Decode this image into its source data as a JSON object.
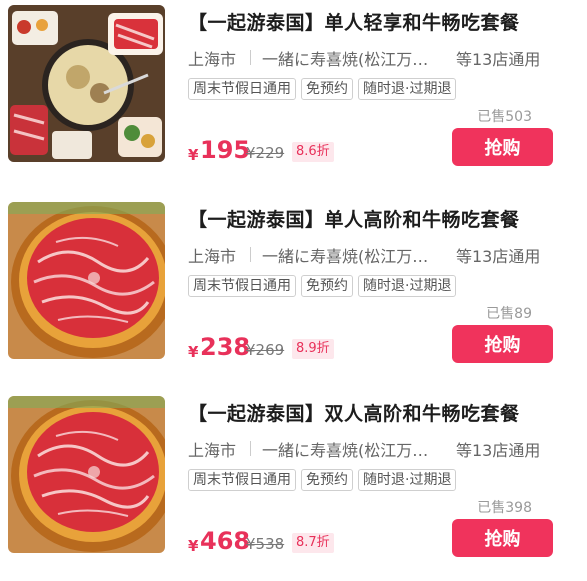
{
  "colors": {
    "accent": "#f0335c",
    "price": "#e8315a",
    "discount_bg": "#fde7ec",
    "muted_text": "#9a9a9a"
  },
  "deals": [
    {
      "image": "hotpot-table-spread-icon",
      "title": "【一起游泰国】单人轻享和牛畅吃套餐",
      "city": "上海市",
      "shop": "一緒に寿喜焼(松江万达店)",
      "stores": "等13店通用",
      "tags": [
        "周末节假日通用",
        "免预约",
        "随时退·过期退"
      ],
      "sold": "已售503",
      "currency": "¥",
      "price": "195",
      "original_price": "¥229",
      "discount": "8.6折",
      "buy_label": "抢购"
    },
    {
      "image": "marbled-beef-plate-icon",
      "title": "【一起游泰国】单人高阶和牛畅吃套餐",
      "city": "上海市",
      "shop": "一緒に寿喜焼(松江万达店)",
      "stores": "等13店通用",
      "tags": [
        "周末节假日通用",
        "免预约",
        "随时退·过期退"
      ],
      "sold": "已售89",
      "currency": "¥",
      "price": "238",
      "original_price": "¥269",
      "discount": "8.9折",
      "buy_label": "抢购"
    },
    {
      "image": "marbled-beef-plate-icon",
      "title": "【一起游泰国】双人高阶和牛畅吃套餐",
      "city": "上海市",
      "shop": "一緒に寿喜焼(松江万达店)",
      "stores": "等13店通用",
      "tags": [
        "周末节假日通用",
        "免预约",
        "随时退·过期退"
      ],
      "sold": "已售398",
      "currency": "¥",
      "price": "468",
      "original_price": "¥538",
      "discount": "8.7折",
      "buy_label": "抢购"
    }
  ]
}
